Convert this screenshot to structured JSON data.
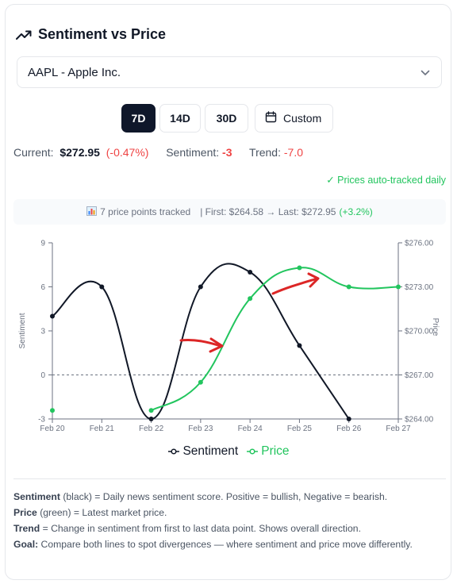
{
  "header": {
    "title": "Sentiment vs Price",
    "icon": "trending-up-icon"
  },
  "stock_select": {
    "value": "AAPL - Apple Inc.",
    "icon": "chevron-down-icon"
  },
  "range_buttons": [
    {
      "label": "7D",
      "active": true
    },
    {
      "label": "14D",
      "active": false
    },
    {
      "label": "30D",
      "active": false
    }
  ],
  "custom_button": {
    "label": "Custom",
    "icon": "calendar-icon"
  },
  "stats": {
    "current_label": "Current:",
    "current_value": "$272.95",
    "current_change": "(-0.47%)",
    "sentiment_label": "Sentiment:",
    "sentiment_value": "-3",
    "trend_label": "Trend:",
    "trend_value": "-7.0"
  },
  "auto_tracked": "✓ Prices auto-tracked daily",
  "tracked_bar": {
    "count_text": "7 price points tracked",
    "range_text": "| First: $264.58 → Last: $272.95",
    "change_text": "(+3.2%)"
  },
  "colors": {
    "sentiment": "#111827",
    "price": "#22c55e",
    "negative": "#ef4444",
    "annotation_arrow": "#dc2626"
  },
  "chart_data": {
    "type": "line",
    "x": [
      "Feb 20",
      "Feb 21",
      "Feb 22",
      "Feb 23",
      "Feb 24",
      "Feb 25",
      "Feb 26",
      "Feb 27"
    ],
    "series": [
      {
        "name": "Sentiment",
        "axis": "left",
        "values": [
          4,
          6,
          -3,
          6,
          7,
          2,
          -3,
          null
        ]
      },
      {
        "name": "Price",
        "axis": "right",
        "values": [
          264.58,
          null,
          264.58,
          266.5,
          272.2,
          274.3,
          273.0,
          273.0
        ]
      }
    ],
    "ylabel": "Sentiment",
    "y2label": "Price",
    "ylim": [
      -3,
      9
    ],
    "y2lim": [
      264,
      276
    ],
    "yticks": [
      "9",
      "6",
      "3",
      "0",
      "-3"
    ],
    "y2ticks": [
      "$276.00",
      "$273.00",
      "$270.00",
      "$267.00",
      "$264.00"
    ],
    "zero_line": "dashed",
    "grid": false,
    "legend": "bottom",
    "annotations": "two red hand-drawn arrows pointing right"
  },
  "legend": {
    "sentiment": "Sentiment",
    "price": "Price"
  },
  "notes": [
    {
      "term": "Sentiment",
      "text": "(black) = Daily news sentiment score. Positive = bullish, Negative = bearish."
    },
    {
      "term": "Price",
      "text": "(green) = Latest market price."
    },
    {
      "term": "Trend",
      "text": "= Change in sentiment from first to last data point. Shows overall direction."
    },
    {
      "term": "Goal:",
      "text": "Compare both lines to spot divergences — where sentiment and price move differently."
    }
  ]
}
